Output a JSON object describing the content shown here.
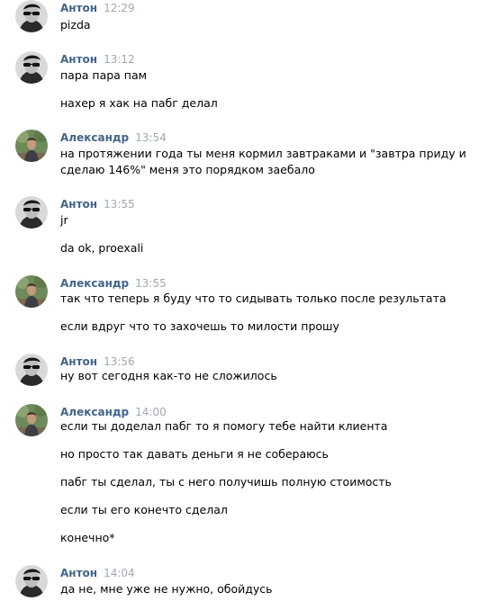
{
  "authors": {
    "anton": "Антон",
    "alexandr": "Александр"
  },
  "times": [
    "12:29",
    "13:12",
    "13:54",
    "13:55",
    "13:55",
    "13:56",
    "14:00",
    "14:04"
  ],
  "lines": [
    "pizda",
    "пара пара пам",
    "нахер я хак на пабг делал",
    "на протяжении года ты меня кормил завтраками и \"завтра приду и",
    "сделаю 146%\" меня это порядком заебало",
    "jr",
    "da ok, proexali",
    "так что теперь я буду что то сидывать только после результата",
    "если вдруг что то захочешь то милости прошу",
    "ну вот сегодня как-то не сложилось",
    "если ты доделал пабг то я помогу тебе найти клиента",
    "но просто так давать деньги я не собераюсь",
    "пабг ты сделал, ты с него получишь полную стоимость",
    "если ты его конечто сделал",
    "конечно*",
    "да не, мне уже не нужно, обойдусь"
  ]
}
